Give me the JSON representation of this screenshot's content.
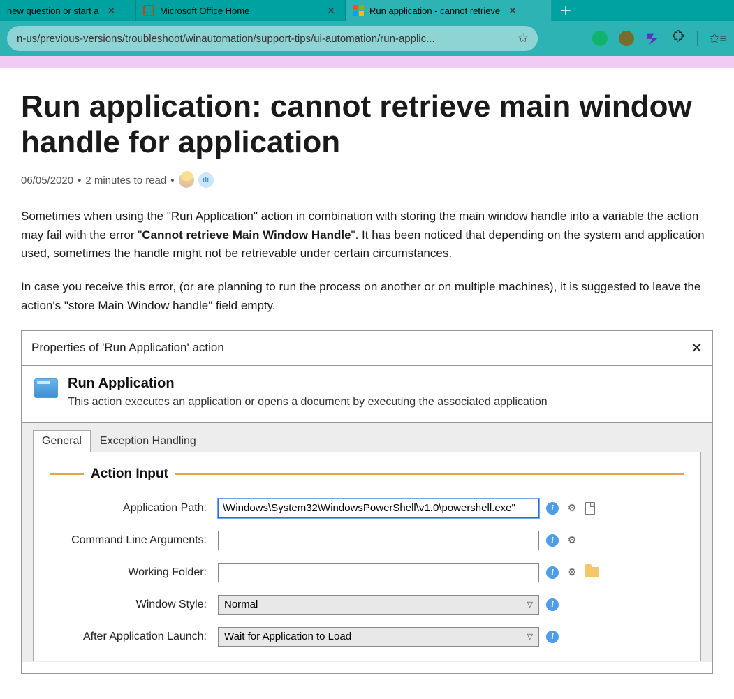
{
  "browser": {
    "tabs": [
      {
        "label": "new question or start a"
      },
      {
        "label": "Microsoft Office Home"
      },
      {
        "label": "Run application - cannot retrieve"
      }
    ],
    "url": "n-us/previous-versions/troubleshoot/winautomation/support-tips/ui-automation/run-applic..."
  },
  "article": {
    "title": "Run application: cannot retrieve main window handle for application",
    "date": "06/05/2020",
    "read_time": "2 minutes to read",
    "p1_a": "Sometimes when using the \"Run Application\" action in combination with storing the main window handle into a variable the action may fail with the error \"",
    "p1_bold": "Cannot retrieve Main Window Handle",
    "p1_b": "\". It has been noticed that depending on the system and application used, sometimes the handle might not be retrievable under certain circumstances.",
    "p2": "In case you receive this error, (or are planning to run the process on another or on multiple machines), it is suggested to leave the action's \"store Main Window handle\" field empty."
  },
  "dialog": {
    "title": "Properties of 'Run Application' action",
    "header_title": "Run Application",
    "header_desc": "This action executes an application or opens a document by executing the associated application",
    "tabs": {
      "general": "General",
      "exception": "Exception Handling"
    },
    "section": "Action Input",
    "fields": {
      "app_path_label": "Application Path:",
      "app_path_value": "\\Windows\\System32\\WindowsPowerShell\\v1.0\\powershell.exe\"",
      "cmd_args_label": "Command Line Arguments:",
      "cmd_args_value": "",
      "working_folder_label": "Working Folder:",
      "working_folder_value": "",
      "window_style_label": "Window Style:",
      "window_style_value": "Normal",
      "after_launch_label": "After Application Launch:",
      "after_launch_value": "Wait for Application to Load"
    }
  },
  "avatar2_text": "ili"
}
